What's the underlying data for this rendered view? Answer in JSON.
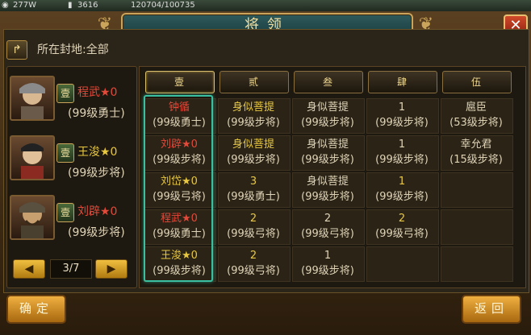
{
  "topbar": {
    "gold": "277W",
    "grain": "3616",
    "misc": "120704/100735"
  },
  "dialog": {
    "title": "将领"
  },
  "fief": {
    "label": "所在封地:全部"
  },
  "left_generals": [
    {
      "badge": "壹",
      "name": "程武★0",
      "name_color": "#e24a3a",
      "level": "(99级勇士)"
    },
    {
      "badge": "壹",
      "name": "王浚★0",
      "name_color": "#e8c840",
      "level": "(99级步将)"
    },
    {
      "badge": "壹",
      "name": "刘辟★0",
      "name_color": "#e24a3a",
      "level": "(99级步将)"
    }
  ],
  "pager": {
    "prev": "◀",
    "page": "3/7",
    "next": "▶"
  },
  "columns": [
    "壹",
    "贰",
    "叁",
    "肆",
    "伍"
  ],
  "grid": [
    [
      {
        "name": "钟循",
        "level": "(99级勇士)",
        "color": "red"
      },
      {
        "name": "刘辟★0",
        "level": "(99级步将)",
        "color": "red"
      },
      {
        "name": "刘岱★0",
        "level": "(99级弓将)",
        "color": "yellow"
      },
      {
        "name": "程武★0",
        "level": "(99级勇士)",
        "color": "red"
      },
      {
        "name": "王浚★0",
        "level": "(99级步将)",
        "color": "yellow"
      }
    ],
    [
      {
        "name": "身似菩提",
        "level": "(99级步将)",
        "color": "yellow"
      },
      {
        "name": "身似菩提",
        "level": "(99级步将)",
        "color": "yellow"
      },
      {
        "name": "3",
        "level": "(99级勇士)",
        "color": "yellow"
      },
      {
        "name": "2",
        "level": "(99级弓将)",
        "color": "yellow"
      },
      {
        "name": "2",
        "level": "(99级弓将)",
        "color": "yellow"
      }
    ],
    [
      {
        "name": "身似菩提",
        "level": "(99级步将)",
        "color": "white"
      },
      {
        "name": "身似菩提",
        "level": "(99级步将)",
        "color": "white"
      },
      {
        "name": "身似菩提",
        "level": "(99级步将)",
        "color": "white"
      },
      {
        "name": "2",
        "level": "(99级弓将)",
        "color": "white"
      },
      {
        "name": "1",
        "level": "(99级步将)",
        "color": "white"
      }
    ],
    [
      {
        "name": "1",
        "level": "(99级步将)",
        "color": "white"
      },
      {
        "name": "1",
        "level": "(99级步将)",
        "color": "white"
      },
      {
        "name": "1",
        "level": "(99级步将)",
        "color": "yellow"
      },
      {
        "name": "2",
        "level": "(99级弓将)",
        "color": "yellow"
      },
      {
        "name": "",
        "level": "",
        "color": "white"
      }
    ],
    [
      {
        "name": "扈臣",
        "level": "(53级步将)",
        "color": "white"
      },
      {
        "name": "幸允君",
        "level": "(15级步将)",
        "color": "white"
      },
      {
        "name": "",
        "level": "",
        "color": "white"
      },
      {
        "name": "",
        "level": "",
        "color": "white"
      },
      {
        "name": "",
        "level": "",
        "color": "white"
      }
    ]
  ],
  "buttons": {
    "confirm": "确定",
    "back": "返回"
  },
  "colors": {
    "red": "#e24a3a",
    "yellow": "#e8c840",
    "white": "#e0d4b8",
    "selection": "#3ac0a0"
  }
}
